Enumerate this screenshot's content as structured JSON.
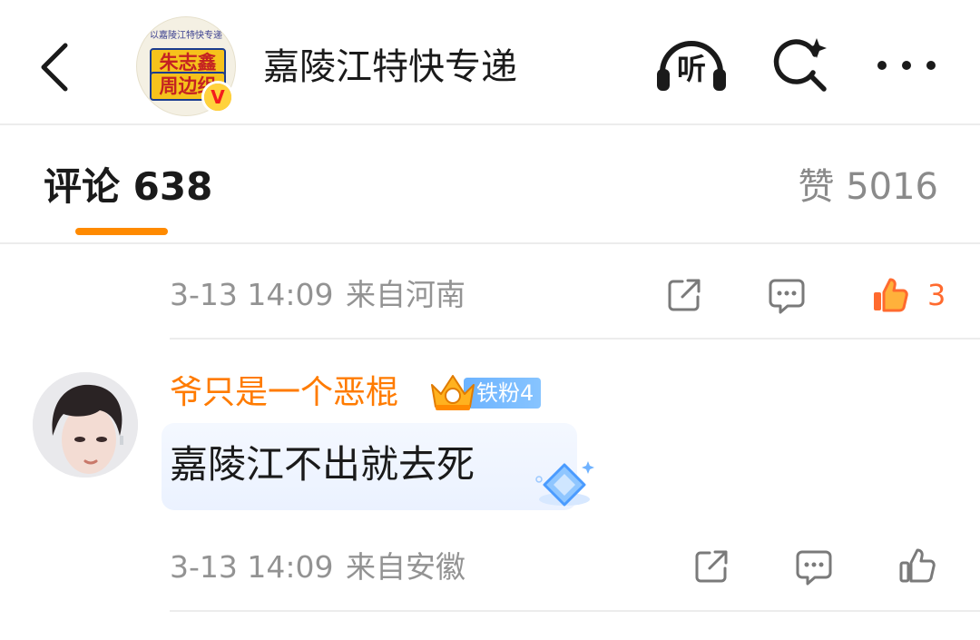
{
  "header": {
    "channel_title": "嘉陵江特快专递",
    "avatar_text_top": "以嘉陵江特快专递",
    "avatar_text_line1": "朱志鑫",
    "avatar_text_line2": "周边组",
    "verified_badge": "V",
    "listen_label": "听",
    "icons": [
      "back-icon",
      "listen-icon",
      "search-sparkle-icon",
      "more-icon"
    ]
  },
  "tabs": {
    "comments_label": "评论 638",
    "likes_label": "赞 5016",
    "accent_color": "#ff8a00"
  },
  "first_comment_meta": {
    "timestamp": "3-13 14:09",
    "location": "来自河南",
    "like_count": "3",
    "liked": true
  },
  "comment": {
    "username": "爷只是一个恶棍",
    "fan_badge": "铁粉4",
    "text": "嘉陵江不出就去死",
    "timestamp": "3-13 14:09",
    "location": "来自安徽",
    "liked": false
  },
  "colors": {
    "username": "#ff7b00",
    "like_active": "#ff6a2e",
    "meta_text": "#939393"
  }
}
